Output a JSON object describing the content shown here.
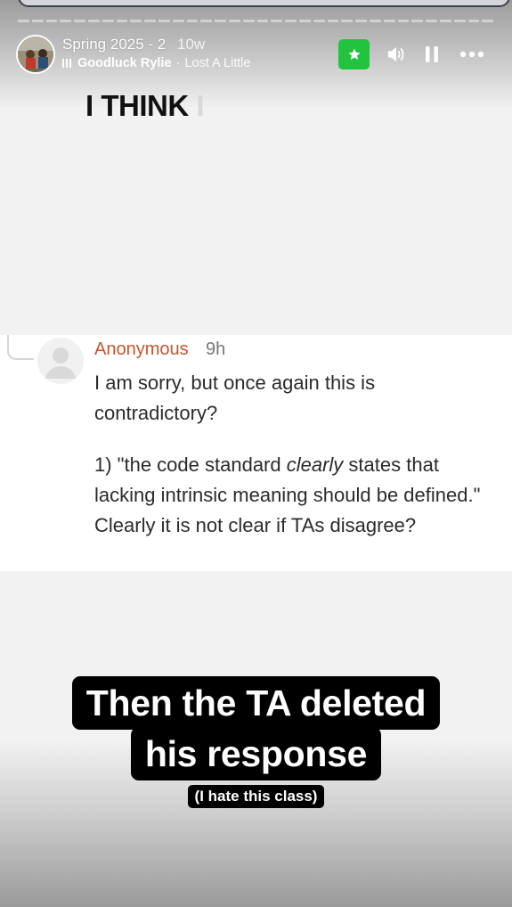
{
  "story": {
    "title": "Spring 2025 - 2",
    "time_ago": "10w",
    "progress": {
      "segments_total": 34,
      "segments_done": 0
    }
  },
  "music": {
    "artist": "Goodluck Rylie",
    "separator": "·",
    "song": "Lost A Little"
  },
  "icons": {
    "close_friends": "star-icon",
    "sound": "speaker-icon",
    "pause": "pause-icon",
    "more": "more-dots-icon"
  },
  "colors": {
    "close_friends_green": "#22c33f",
    "author_color": "#c6552a"
  },
  "overlay_text": {
    "typed": "I THINK",
    "cursor": "I"
  },
  "comment": {
    "author": "Anonymous",
    "time": "9h",
    "paragraph1": "I am sorry, but once again this is contradictory?",
    "p2_before": "1) \"the code standard ",
    "p2_emphasis": "clearly",
    "p2_after": " states that lacking intrinsic meaning should be defined.\" Clearly it is not clear if TAs disagree?"
  },
  "caption": {
    "line1": "Then the TA deleted",
    "line2": "his response",
    "sub": "(I hate this class)"
  }
}
